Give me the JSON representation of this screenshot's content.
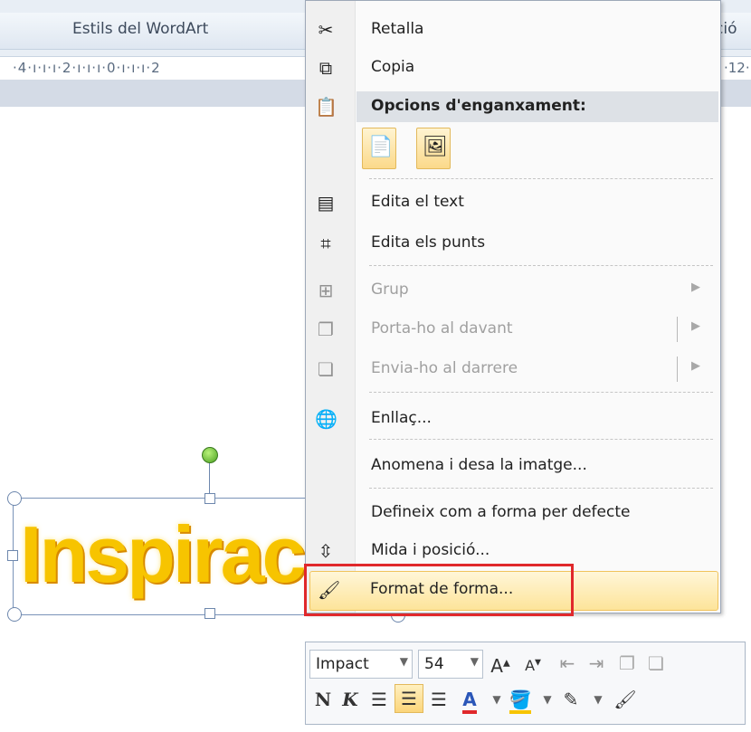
{
  "ribbon": {
    "group_label": "Estils del WordArt",
    "group_label_right": "ció",
    "ruler_text": "·4·ı·ı·ı·2·ı·ı·ı·0·ı·ı·ı·2",
    "ruler_text_right": "·12·"
  },
  "wordart": {
    "text": "Inspirac"
  },
  "context_menu": {
    "cut": "Retalla",
    "copy": "Copia",
    "paste_options": "Opcions d'enganxament:",
    "edit_text": "Edita el text",
    "edit_points": "Edita els punts",
    "group": "Grup",
    "bring_forward": "Porta-ho al davant",
    "send_backward": "Envia-ho al darrere",
    "link": "Enllaç...",
    "save_image": "Anomena i desa la imatge...",
    "set_default": "Defineix com a forma per defecte",
    "size_position": "Mida i posició...",
    "format_shape": "Format de forma..."
  },
  "mini_toolbar": {
    "font": "Impact",
    "size": "54",
    "bold": "N",
    "italic": "K"
  },
  "colors": {
    "highlight": "#fde49a",
    "red_box": "#e0282b",
    "wordart": "#f7c400"
  }
}
